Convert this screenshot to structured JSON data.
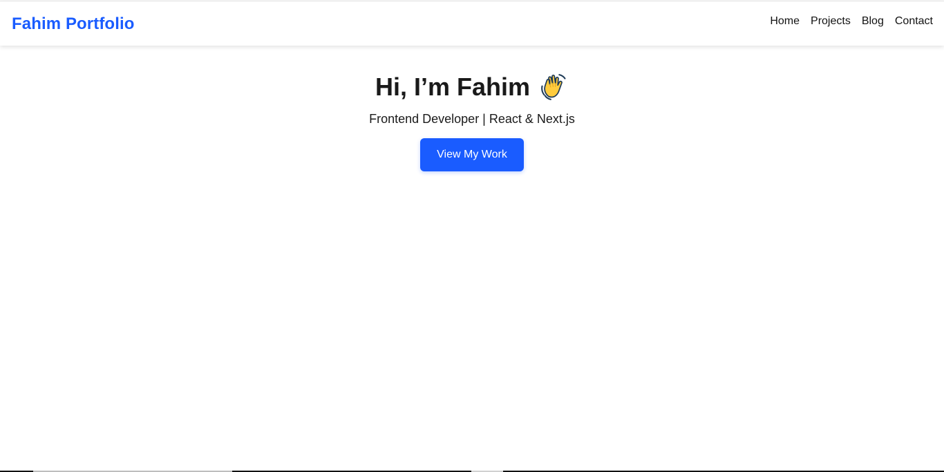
{
  "navbar": {
    "brand": "Fahim Portfolio",
    "links": [
      {
        "label": "Home"
      },
      {
        "label": "Projects"
      },
      {
        "label": "Blog"
      },
      {
        "label": "Contact"
      }
    ]
  },
  "hero": {
    "title": "Hi, I’m Fahim",
    "icon": "waving-hand-icon",
    "subtitle": "Frontend Developer | React & Next.js",
    "cta_label": "View My Work"
  },
  "colors": {
    "brand": "#1a5cff",
    "text": "#1a1a1a",
    "background": "#ffffff"
  }
}
